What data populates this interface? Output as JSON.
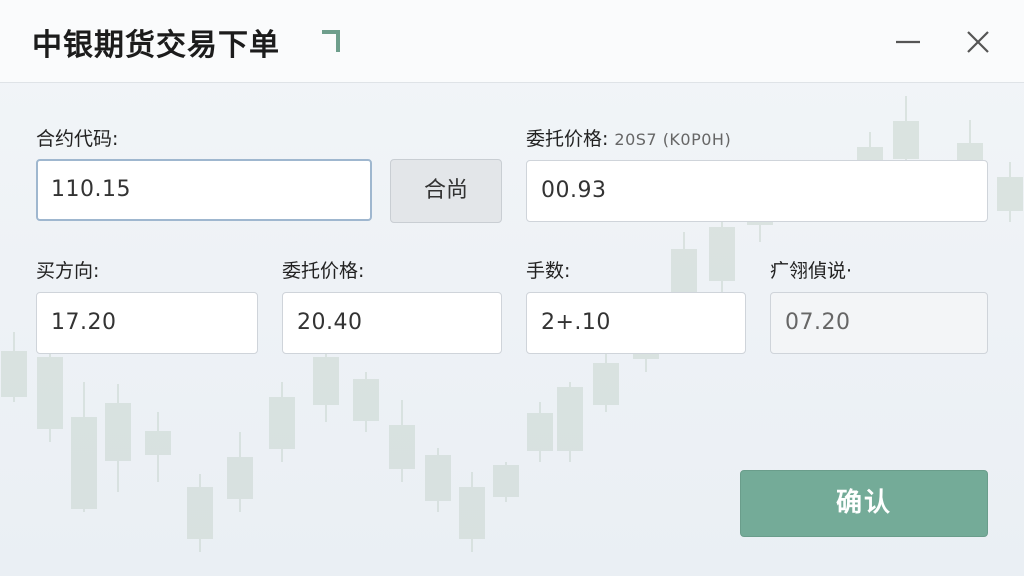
{
  "window": {
    "title": "中银期货交易下单",
    "minimize_icon": "minimize-icon",
    "close_icon": "close-icon"
  },
  "form": {
    "contract_code": {
      "label": "合约代码:",
      "value": "110.15"
    },
    "lookup_button": {
      "label": "合尚"
    },
    "order_price_top": {
      "label": "委托价格:",
      "sublabel": "20S7 (K0P0H)",
      "value": "00.93"
    },
    "buy_direction": {
      "label": "买方向:",
      "value": "17.20"
    },
    "order_price": {
      "label": "委托价格:",
      "value": "20.40"
    },
    "lots": {
      "label": "手数:",
      "value": "2+.10"
    },
    "extra": {
      "label": "疒翎偵说·",
      "value": "07.20"
    },
    "confirm_button": {
      "label": "确认"
    }
  },
  "colors": {
    "accent": "#74ab98",
    "focus_border": "#9fb7cf"
  }
}
